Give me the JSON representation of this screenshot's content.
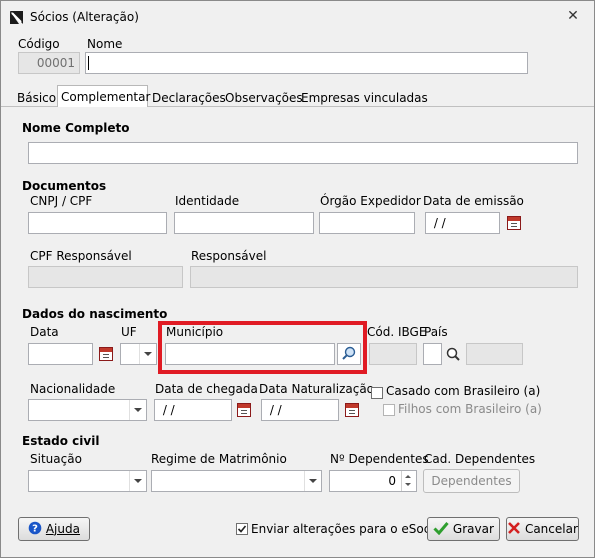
{
  "window": {
    "title": "Sócios (Alteração)"
  },
  "header": {
    "codigo_label": "Código",
    "codigo_value": "00001",
    "nome_label": "Nome",
    "nome_value": ""
  },
  "tabs": [
    "Básico",
    "Complementar",
    "Declarações",
    "Observações",
    "Empresas vinculadas"
  ],
  "active_tab": "Complementar",
  "form": {
    "nome_completo_label": "Nome Completo",
    "documentos_label": "Documentos",
    "cnpj_label": "CNPJ / CPF",
    "identidade_label": "Identidade",
    "orgao_label": "Órgão Expedidor",
    "data_emissao_label": "Data de emissão",
    "data_emissao_value": " / /",
    "cpf_resp_label": "CPF Responsável",
    "responsavel_label": "Responsável",
    "dados_nasc_label": "Dados do nascimento",
    "data_label": "Data",
    "uf_label": "UF",
    "municipio_label": "Município",
    "cod_ibge_label": "Cód. IBGE",
    "pais_label": "País",
    "nacionalidade_label": "Nacionalidade",
    "data_chegada_label": "Data de chegada",
    "data_chegada_value": " / /",
    "data_natur_label": "Data Naturalização",
    "data_natur_value": " / /",
    "casado_label": "Casado com Brasileiro (a)",
    "filhos_label": "Filhos com Brasileiro (a)",
    "estado_civil_label": "Estado civil",
    "situacao_label": "Situação",
    "regime_label": "Regime de Matrimônio",
    "num_dep_label": "Nº Dependentes",
    "num_dep_value": "0",
    "cad_dep_label": "Cad. Dependentes",
    "dependentes_button": "Dependentes"
  },
  "footer": {
    "ajuda": "Ajuda",
    "esocial_label": "Enviar alterações para o eSocial",
    "gravar": "Gravar",
    "cancelar": "Cancelar"
  },
  "colors": {
    "highlight": "#e01b24",
    "ok": "#2e9e2e",
    "cancel": "#d42020",
    "help": "#1a56c8"
  }
}
